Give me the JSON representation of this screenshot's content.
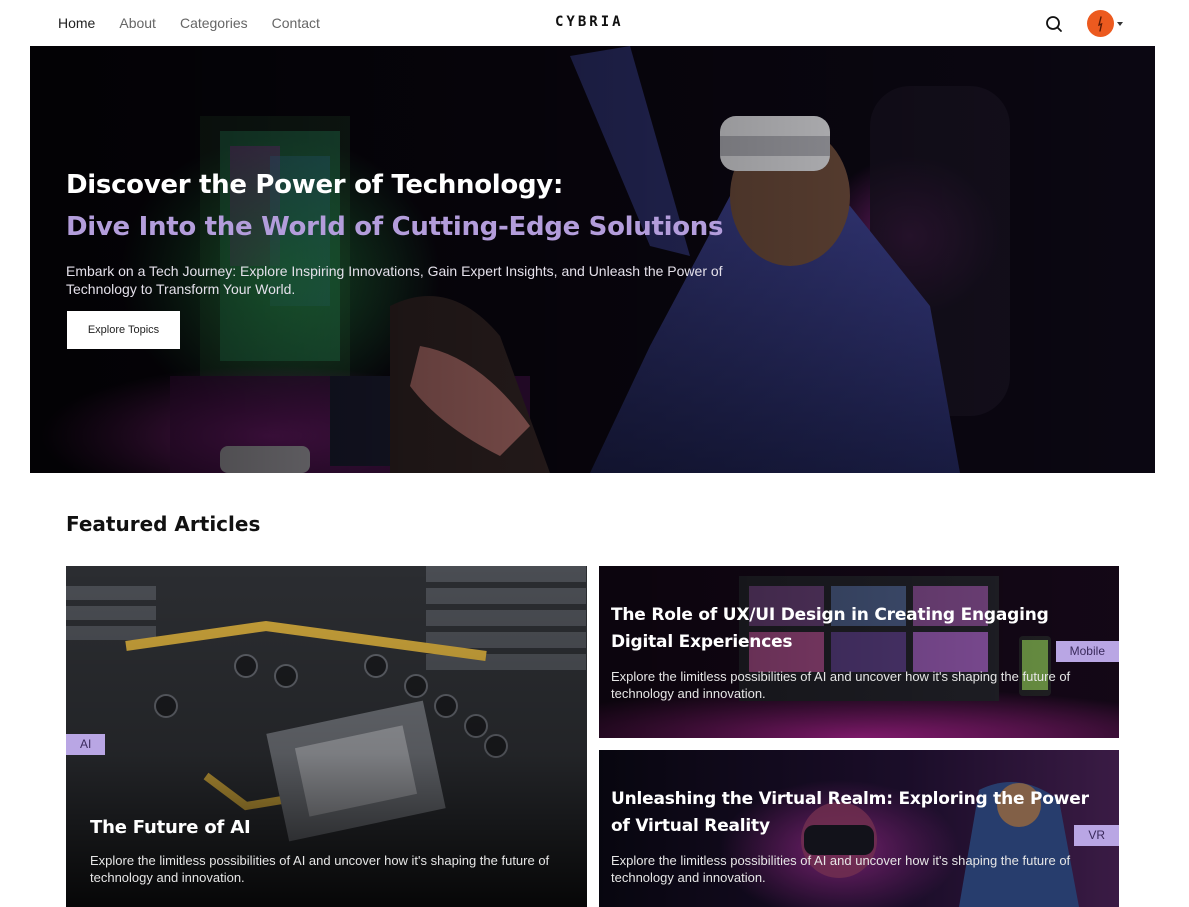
{
  "nav": {
    "links": [
      "Home",
      "About",
      "Categories",
      "Contact"
    ],
    "logo": "CYBRIA",
    "search_icon": "search-icon",
    "avatar_icon": "user-avatar-icon"
  },
  "hero": {
    "title": "Discover the Power of Technology:",
    "subtitle": "Dive Into the World of Cutting-Edge Solutions",
    "description": "Embark on a Tech Journey: Explore Inspiring Innovations, Gain Expert Insights, and Unleash the Power of Technology to Transform Your World.",
    "button_label": "Explore Topics"
  },
  "featured": {
    "heading": "Featured Articles",
    "articles": [
      {
        "title": "The Future of AI",
        "description": "Explore the limitless possibilities of AI and uncover how it's shaping the future of technology and innovation.",
        "tag": "AI"
      },
      {
        "title": "The Role of UX/UI Design in Creating Engaging Digital Experiences",
        "description": "Explore the limitless possibilities of AI and uncover how it's shaping the future of technology and innovation.",
        "tag": "Mobile"
      },
      {
        "title": "Unleashing the Virtual Realm: Exploring the Power of Virtual Reality",
        "description": "Explore the limitless possibilities of AI and uncover how it's shaping the future of technology and innovation.",
        "tag": "VR"
      }
    ]
  },
  "colors": {
    "accent": "#b39ddb",
    "tag_bg": "#b9a6e4",
    "avatar": "#ec5a1f"
  }
}
